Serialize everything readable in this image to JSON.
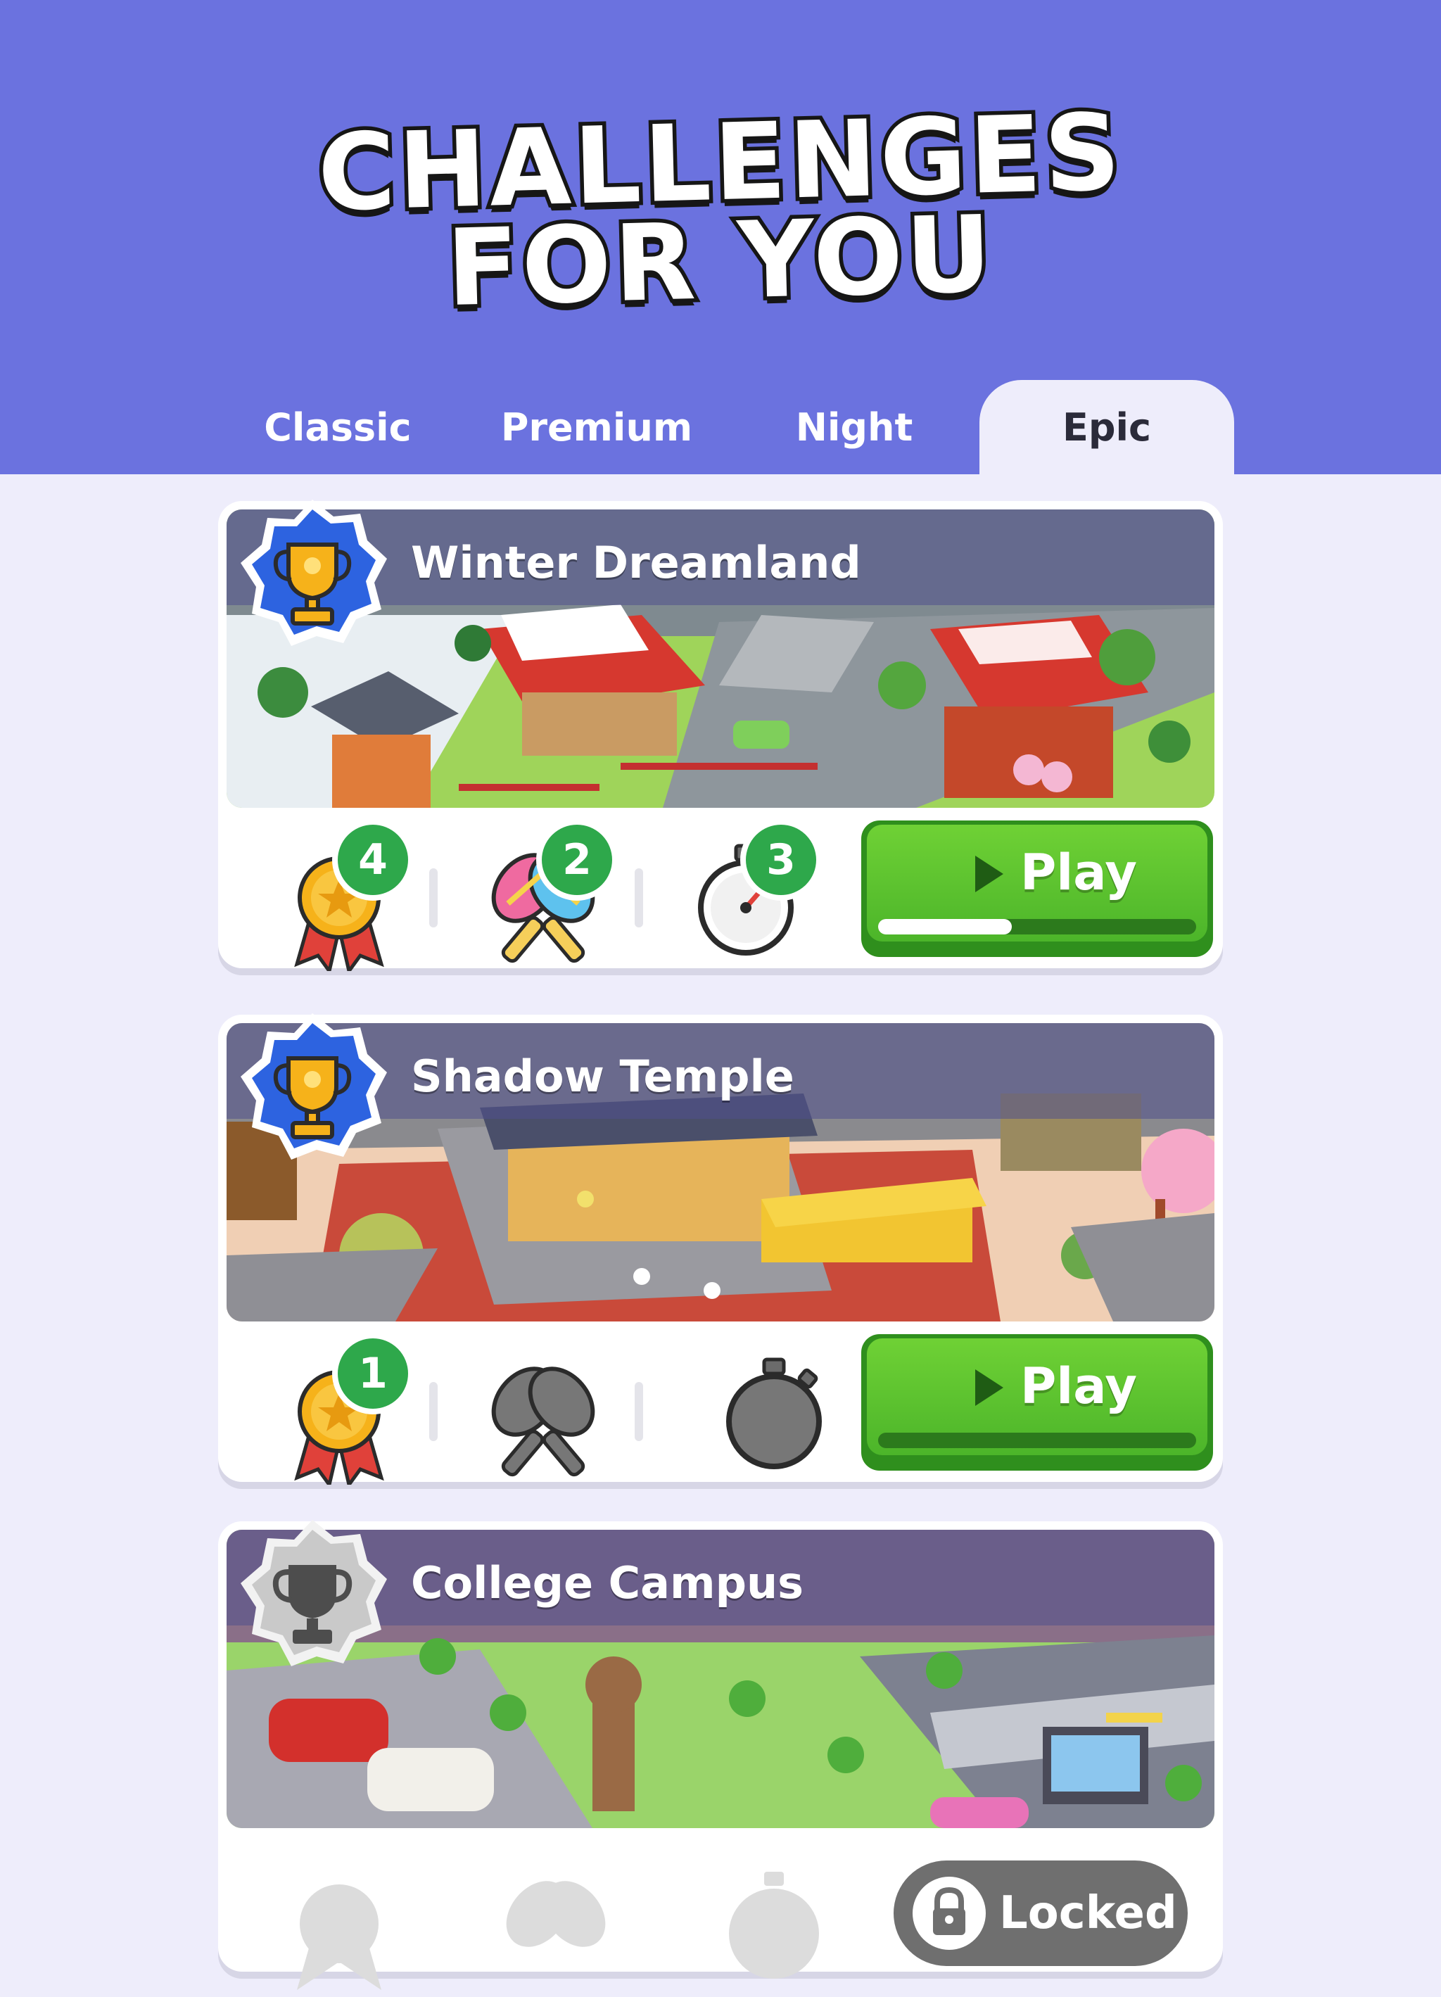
{
  "header": {
    "title_line1": "CHALLENGES",
    "title_line2": "FOR YOU",
    "background_color": "#6b72df"
  },
  "tabs": [
    {
      "label": "Classic",
      "active": false
    },
    {
      "label": "Premium",
      "active": false
    },
    {
      "label": "Night",
      "active": false
    },
    {
      "label": "Epic",
      "active": true
    }
  ],
  "challenges": [
    {
      "name": "Winter Dreamland",
      "trophy": "gold-trophy",
      "stats": {
        "medals": "4",
        "maracas": "2",
        "stopwatch": "3"
      },
      "action": "Play",
      "progress": 0.42
    },
    {
      "name": "Shadow Temple",
      "trophy": "gold-trophy",
      "stats": {
        "medals": "1"
      },
      "action": "Play",
      "progress": 0.0
    },
    {
      "name": "College Campus",
      "trophy": "grey-trophy",
      "action": "Locked"
    }
  ],
  "colors": {
    "play_green": "#4cb52a",
    "count_badge_green": "#2ea84b",
    "badge_blue": "#2d63e0"
  }
}
